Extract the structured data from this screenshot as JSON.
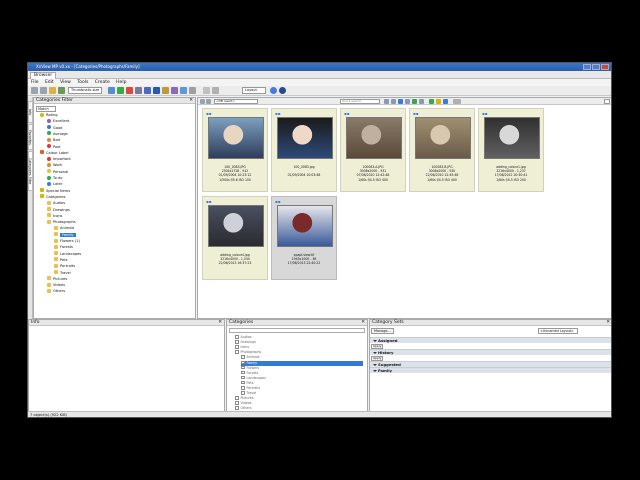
{
  "window": {
    "title": "XnView MP v0.xx - [Categories/Photographs/Family]",
    "tab": "Browser",
    "menu": [
      "File",
      "Edit",
      "View",
      "Tools",
      "Create",
      "Help"
    ]
  },
  "toolbar": {
    "view_mode": "Thumbnails size",
    "layout": "Layout"
  },
  "side_tabs": [
    "Info",
    "Favorites",
    "Categories filter"
  ],
  "category_filter": {
    "title": "Categories Filter",
    "match": "Match",
    "tree": [
      {
        "label": "Rating",
        "depth": 0,
        "icon": "star-icon",
        "color": "#d8b400"
      },
      {
        "label": "Excellent",
        "depth": 1,
        "icon": "star-icon",
        "color": "#8e5ed8"
      },
      {
        "label": "Good",
        "depth": 1,
        "icon": "star-icon",
        "color": "#3a7bd5"
      },
      {
        "label": "Average",
        "depth": 1,
        "icon": "star-icon",
        "color": "#2eaa4a"
      },
      {
        "label": "Bad",
        "depth": 1,
        "icon": "star-icon",
        "color": "#e08a2e"
      },
      {
        "label": "Poor",
        "depth": 1,
        "icon": "star-icon",
        "color": "#d83a3a"
      },
      {
        "label": "Colour Label",
        "depth": 0,
        "icon": "palette-icon",
        "color": "#cc6a2a"
      },
      {
        "label": "Important",
        "depth": 1,
        "icon": "color-dot-icon",
        "color": "#d83a3a"
      },
      {
        "label": "Work",
        "depth": 1,
        "icon": "color-dot-icon",
        "color": "#e08a2e"
      },
      {
        "label": "Personal",
        "depth": 1,
        "icon": "color-dot-icon",
        "color": "#d8c82e"
      },
      {
        "label": "To do",
        "depth": 1,
        "icon": "color-dot-icon",
        "color": "#2eaa4a"
      },
      {
        "label": "Later",
        "depth": 1,
        "icon": "color-dot-icon",
        "color": "#3a7bd5"
      },
      {
        "label": "Special Items",
        "depth": 0,
        "icon": "folder-icon",
        "color": "#d8b400"
      },
      {
        "label": "Categories",
        "depth": 0,
        "icon": "folder-icon",
        "color": "#d8b400"
      },
      {
        "label": "Audios",
        "depth": 1,
        "icon": "folder-icon",
        "color": "#e8c24a"
      },
      {
        "label": "Drawings",
        "depth": 1,
        "icon": "folder-icon",
        "color": "#e8c24a"
      },
      {
        "label": "Icons",
        "depth": 1,
        "icon": "folder-icon",
        "color": "#e8c24a"
      },
      {
        "label": "Photographs",
        "depth": 1,
        "icon": "folder-icon",
        "color": "#e8c24a"
      },
      {
        "label": "Animals",
        "depth": 2,
        "icon": "folder-icon",
        "color": "#e8c24a"
      },
      {
        "label": "Family",
        "depth": 2,
        "icon": "folder-icon",
        "color": "#e8c24a",
        "selected": true
      },
      {
        "label": "Flowers (1)",
        "depth": 2,
        "icon": "folder-icon",
        "color": "#e8c24a"
      },
      {
        "label": "Forests",
        "depth": 2,
        "icon": "folder-icon",
        "color": "#e8c24a"
      },
      {
        "label": "Landscapes",
        "depth": 2,
        "icon": "folder-icon",
        "color": "#e8c24a"
      },
      {
        "label": "Pets",
        "depth": 2,
        "icon": "folder-icon",
        "color": "#e8c24a"
      },
      {
        "label": "Portraits",
        "depth": 2,
        "icon": "folder-icon",
        "color": "#e8c24a"
      },
      {
        "label": "Travel",
        "depth": 2,
        "icon": "folder-icon",
        "color": "#e8c24a"
      },
      {
        "label": "Pictures",
        "depth": 1,
        "icon": "folder-icon",
        "color": "#e8c24a"
      },
      {
        "label": "Videos",
        "depth": 1,
        "icon": "folder-icon",
        "color": "#e8c24a"
      },
      {
        "label": "Others",
        "depth": 1,
        "icon": "folder-icon",
        "color": "#e8c24a"
      }
    ]
  },
  "browser": {
    "path": "<DB result>",
    "search_placeholder": "Quick search",
    "thumbnails": [
      {
        "name": "100_0083.JPG",
        "line2": "2304x1728 - 912",
        "line3": "01/09/2004 10:23:12",
        "line4": "1/500s f/5.6 ISO 100",
        "colors": [
          "#7d9fc0",
          "#e8d6c0",
          "#2e3d5a"
        ],
        "selected": false
      },
      {
        "name": "100_0083.jpg",
        "line2": "",
        "line3": "01/09/2004 10:03:48",
        "line4": "",
        "colors": [
          "#1a1a1a",
          "#f0d8c8",
          "#2e4a7a"
        ],
        "selected": false
      },
      {
        "name": "100083.A.JPG",
        "line2": "3008x2000 - 931",
        "line3": "07/08/2010 12:42:48",
        "line4": "1/60s f/4.5 ISO 400",
        "colors": [
          "#8a7a6a",
          "#c0b0a0",
          "#5a4a3a"
        ],
        "selected": false
      },
      {
        "name": "100083.B.JPG",
        "line2": "3008x2000 - 930",
        "line3": "22/06/2010 12:45:48",
        "line4": "1/60s f/4.5 ISO 400",
        "colors": [
          "#a09070",
          "#d8c8b0",
          "#6a5a4a"
        ],
        "selected": false
      },
      {
        "name": "adding_colour1.jpg",
        "line2": "3216x4000 - 1,237",
        "line3": "17/08/2012 20:30:41",
        "line4": "1/60s f/4.5 ISO 200",
        "colors": [
          "#303030",
          "#d8d8d8",
          "#606060"
        ],
        "selected": false
      },
      {
        "name": "adding_colour4.jpg",
        "line2": "3216x4000 - 1,034",
        "line3": "22/06/2013 16:37:23",
        "line4": "",
        "colors": [
          "#4a5060",
          "#d0d0d8",
          "#2a2a30"
        ],
        "selected": false
      },
      {
        "name": "ppapl-view.tif",
        "line2": "1945x1000 - 38",
        "line3": "17/06/2013 22:40:22",
        "line4": "",
        "colors": [
          "#e6e6ea",
          "#7a2a2a",
          "#3a5a9a"
        ],
        "selected": true
      }
    ]
  },
  "info_panel": {
    "title": "Info"
  },
  "categories_panel": {
    "title": "Categories",
    "items": [
      {
        "label": "Audios",
        "depth": 0
      },
      {
        "label": "Drawings",
        "depth": 0
      },
      {
        "label": "Icons",
        "depth": 0
      },
      {
        "label": "Photographs",
        "depth": 0
      },
      {
        "label": "Animals",
        "depth": 1
      },
      {
        "label": "Family",
        "depth": 1,
        "selected": true
      },
      {
        "label": "Flowers",
        "depth": 1
      },
      {
        "label": "Forests",
        "depth": 1
      },
      {
        "label": "Landscapes",
        "depth": 1
      },
      {
        "label": "Pets",
        "depth": 1
      },
      {
        "label": "Portraits",
        "depth": 1
      },
      {
        "label": "Travel",
        "depth": 1
      },
      {
        "label": "Pictures",
        "depth": 0
      },
      {
        "label": "Videos",
        "depth": 0
      },
      {
        "label": "Others",
        "depth": 0
      }
    ]
  },
  "category_sets": {
    "title": "Category Sets",
    "manage": "Manage...",
    "dropdown": "<Unnamed Layout>",
    "sections": [
      {
        "label": "Assigned",
        "button": "Apply"
      },
      {
        "label": "History",
        "button": "Apply"
      },
      {
        "label": "Suggested",
        "button": ""
      },
      {
        "label": "Family",
        "button": ""
      }
    ]
  },
  "status": {
    "text": "7 object(s) (922 KiB)"
  }
}
